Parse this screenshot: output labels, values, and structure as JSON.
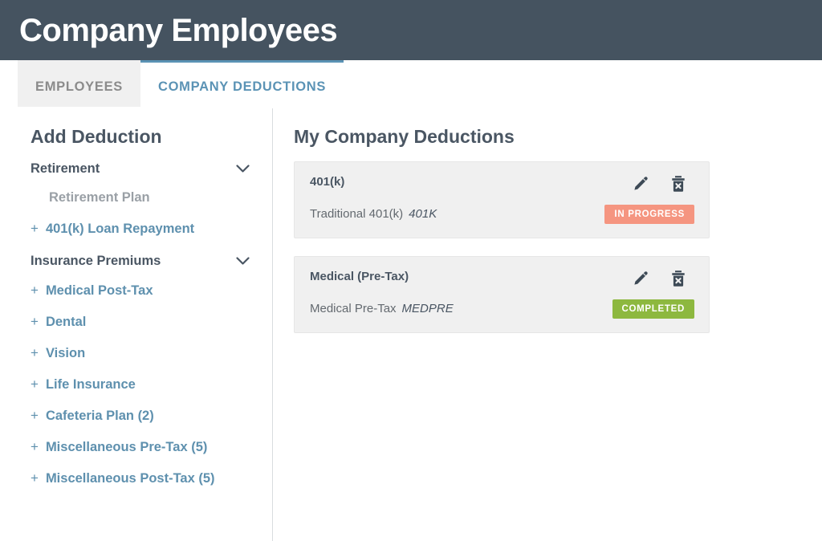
{
  "header": {
    "title": "Company Employees",
    "background": "#455360"
  },
  "tabs": [
    {
      "label": "EMPLOYEES",
      "active": false
    },
    {
      "label": "COMPANY DEDUCTIONS",
      "active": true
    }
  ],
  "sidebar": {
    "title": "Add Deduction",
    "sections": [
      {
        "title": "Retirement",
        "chevron": "chevron-down-icon",
        "items": [
          {
            "label": "Retirement Plan",
            "disabled": true,
            "prefix": ""
          },
          {
            "label": "401(k) Loan Repayment",
            "disabled": false,
            "prefix": "+"
          }
        ]
      },
      {
        "title": "Insurance Premiums",
        "chevron": "chevron-down-icon",
        "items": [
          {
            "label": "Medical Post-Tax",
            "disabled": false,
            "prefix": "+"
          },
          {
            "label": "Dental",
            "disabled": false,
            "prefix": "+"
          },
          {
            "label": "Vision",
            "disabled": false,
            "prefix": "+"
          },
          {
            "label": "Life Insurance",
            "disabled": false,
            "prefix": "+"
          },
          {
            "label": "Cafeteria Plan (2)",
            "disabled": false,
            "prefix": "+"
          },
          {
            "label": "Miscellaneous Pre-Tax (5)",
            "disabled": false,
            "prefix": "+"
          },
          {
            "label": "Miscellaneous Post-Tax (5)",
            "disabled": false,
            "prefix": "+"
          }
        ]
      }
    ]
  },
  "main": {
    "title": "My Company Deductions",
    "cards": [
      {
        "name": "401(k)",
        "description": "Traditional 401(k)",
        "code": "401K",
        "status": "IN PROGRESS",
        "status_color": "#f59580",
        "edit_icon": "pencil-icon",
        "delete_icon": "trash-icon"
      },
      {
        "name": "Medical (Pre-Tax)",
        "description": "Medical Pre-Tax",
        "code": "MEDPRE",
        "status": "COMPLETED",
        "status_color": "#8db83f",
        "edit_icon": "pencil-icon",
        "delete_icon": "trash-icon"
      }
    ]
  },
  "colors": {
    "accent_blue": "#5b93b5",
    "link_blue": "#5e90ae",
    "text_dark": "#4a5663",
    "muted_gray": "#9aa0a6"
  }
}
